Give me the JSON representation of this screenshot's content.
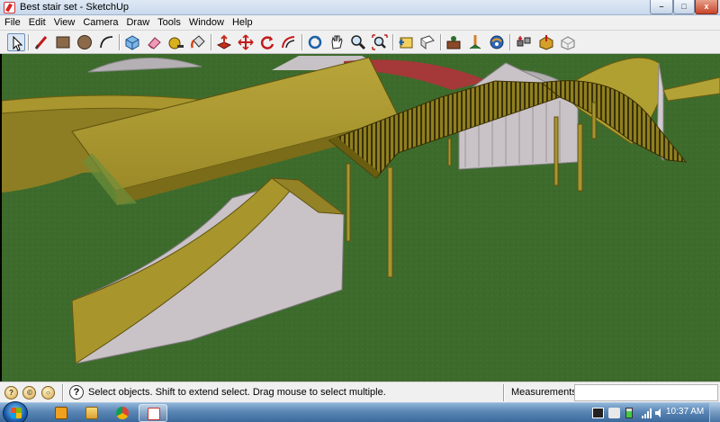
{
  "window": {
    "title": "Best stair set - SketchUp",
    "controls": {
      "minimize": "–",
      "maximize": "□",
      "close": "x"
    }
  },
  "menu": {
    "items": [
      "File",
      "Edit",
      "View",
      "Camera",
      "Draw",
      "Tools",
      "Window",
      "Help"
    ]
  },
  "toolbar": {
    "tools": [
      "select-icon",
      "line-icon",
      "rectangle-icon",
      "circle-icon",
      "arc-icon",
      "make-component-icon",
      "eraser-icon",
      "tape-measure-icon",
      "paint-bucket-icon",
      "push-pull-icon",
      "move-icon",
      "rotate-icon",
      "offset-icon",
      "orbit-icon",
      "pan-icon",
      "zoom-icon",
      "zoom-extents-icon",
      "previous-view-icon",
      "next-view-icon",
      "components-icon",
      "position-camera-icon",
      "look-around-icon",
      "get-models-icon",
      "share-model-icon",
      "share-component-icon",
      "3d-warehouse-icon"
    ],
    "active": "select-icon"
  },
  "status": {
    "hint": "Select objects. Shift to extend select. Drag mouse to select multiple.",
    "help_glyph": "?",
    "icons": [
      "geo-location-icon",
      "credits-icon",
      "sign-in-icon"
    ],
    "measurements_label": "Measurements",
    "measurements_value": ""
  },
  "taskbar": {
    "apps": [
      "media-player-icon",
      "file-explorer-icon",
      "chrome-icon",
      "sketchup-icon"
    ],
    "active_app": "sketchup-icon",
    "tray": [
      "ccleaner-icon",
      "action-center-icon",
      "battery-icon",
      "network-signal-icon",
      "volume-icon"
    ],
    "clock": "10:37 AM"
  },
  "colors": {
    "ground": "#3d6b2c",
    "ramp_surface": "#a9962e",
    "ramp_side": "#c9c3c7",
    "accent_blue": "#1d5fa8"
  }
}
